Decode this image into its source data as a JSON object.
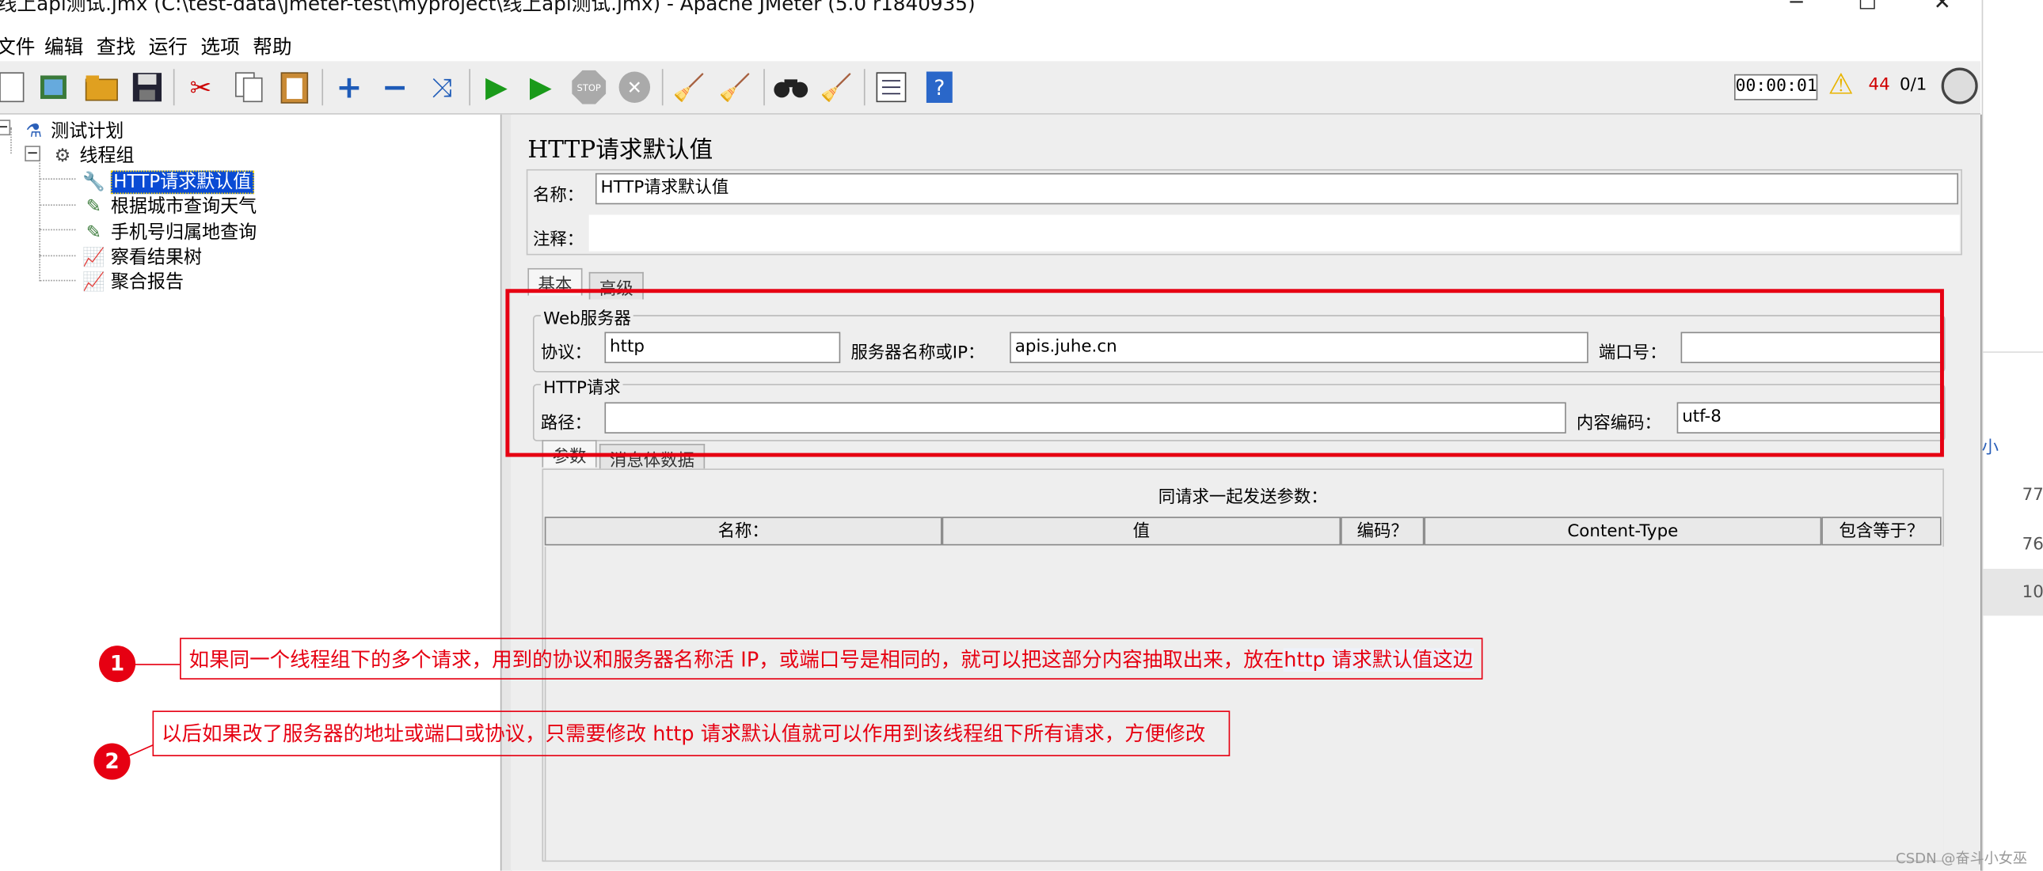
{
  "window": {
    "title": "线上api测试.jmx (C:\\test-data\\jmeter-test\\myproject\\线上api测试.jmx) - Apache JMeter (5.0 r1840935)",
    "minimize": "─",
    "maximize": "☐",
    "close": "✕"
  },
  "menu": [
    "文件",
    "编辑",
    "查找",
    "运行",
    "选项",
    "帮助"
  ],
  "status": {
    "timer": "00:00:01",
    "error_count": "44",
    "threads": "0/1"
  },
  "tree": {
    "items": [
      {
        "label": "测试计划",
        "icon": "flask-icon"
      },
      {
        "label": "线程组",
        "icon": "gear-icon"
      },
      {
        "label": "HTTP请求默认值",
        "icon": "wrench-icon"
      },
      {
        "label": "根据城市查询天气",
        "icon": "pipette-icon"
      },
      {
        "label": "手机号归属地查询",
        "icon": "pipette-icon"
      },
      {
        "label": "察看结果树",
        "icon": "graph-icon"
      },
      {
        "label": "聚合报告",
        "icon": "graph-icon"
      }
    ]
  },
  "panel": {
    "title": "HTTP请求默认值",
    "name_label": "名称：",
    "name_value": "HTTP请求默认值",
    "comment_label": "注释：",
    "tabs": [
      "基本",
      "高级"
    ],
    "web_server": {
      "legend": "Web服务器",
      "protocol_label": "协议：",
      "protocol_value": "http",
      "server_label": "服务器名称或IP：",
      "server_value": "apis.juhe.cn",
      "port_label": "端口号：",
      "port_value": ""
    },
    "http_request": {
      "legend": "HTTP请求",
      "path_label": "路径：",
      "path_value": "",
      "encoding_label": "内容编码：",
      "encoding_value": "utf-8"
    },
    "param_tabs": [
      "参数",
      "消息体数据"
    ],
    "params": {
      "caption": "同请求一起发送参数：",
      "columns": [
        "名称：",
        "值",
        "编码？",
        "Content-Type",
        "包含等于？"
      ]
    }
  },
  "annotations": [
    {
      "number": "1",
      "text_before": "如果同一个线程组下的多个请求，用到的协议和服务器名称活 IP，或端口号是相同的，就可以把这部分内容抽取出来，放在",
      "text_highlight": "http 请求默认值这边"
    },
    {
      "number": "2",
      "text": "以后如果改了服务器的地址或端口或协议，只需要修改 http 请求默认值就可以作用到该线程组下所有请求，方便修改"
    }
  ],
  "right_strip": {
    "label": "小",
    "numbers": [
      "77",
      "76",
      "10"
    ]
  },
  "watermark": "CSDN @奋斗小女巫",
  "colors": {
    "annotation_red": "#e60012",
    "selection_blue": "#0a4bd4",
    "run_green": "#1a9a1a"
  }
}
